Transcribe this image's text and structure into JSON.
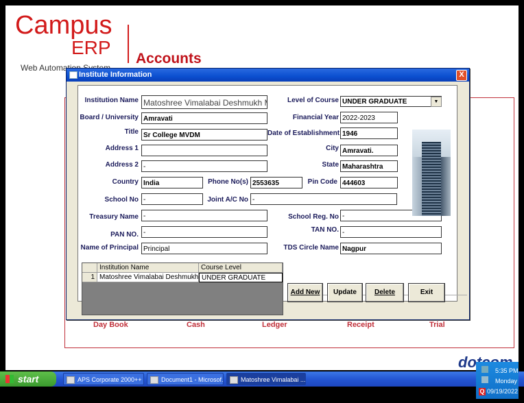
{
  "app": {
    "logo_campus": "Campus",
    "logo_erp": "ERP",
    "logo_subtitle": "Web Automation System",
    "module_title": "Accounts",
    "brand_footer": "dotcom"
  },
  "background_tabs": [
    "Day Book",
    "Cash",
    "Ledger",
    "Receipt",
    "Trial"
  ],
  "dialog": {
    "title": "Institute Information",
    "close": "X",
    "labels": {
      "institution_name": "Institution Name",
      "board_university": "Board / University",
      "title": "Title",
      "address1": "Address 1",
      "address2": "Address 2",
      "country": "Country",
      "phone": "Phone No(s)",
      "pin_code": "Pin Code",
      "school_no": "School No",
      "joint_ac": "Joint A/C No",
      "treasury_name": "Treasury Name",
      "school_reg_no": "School Reg. No",
      "pan_no": "PAN NO.",
      "tan_no": "TAN NO.",
      "principal": "Name of Principal",
      "tds_circle": "TDS Circle Name",
      "level_of_course": "Level of Course",
      "financial_year": "Financial Year",
      "date_established": "Date of Establishment",
      "city": "City",
      "state": "State"
    },
    "values": {
      "institution_name": "Matoshree Vimalabai Deshmukh M",
      "board_university": "Amravati",
      "title": "Sr College MVDM",
      "address1": "",
      "address2": "-",
      "country": "India",
      "phone": "2553635",
      "pin_code": "444603",
      "school_no": "-",
      "joint_ac": "-",
      "treasury_name": "-",
      "school_reg_no": "-",
      "pan_no": "-",
      "tan_no": "-",
      "principal": "Principal",
      "tds_circle": "Nagpur",
      "level_of_course": "UNDER GRADUATE",
      "financial_year": "2022-2023",
      "date_established": "1946",
      "city": "Amravati.",
      "state": "Maharashtra"
    },
    "grid": {
      "columns": [
        "Institution Name",
        "Course Level"
      ],
      "rows": [
        {
          "num": "1",
          "name": "Matoshree Vimalabai Deshmukh",
          "level": "UNDER GRADUATE"
        }
      ]
    },
    "buttons": {
      "add_new": "Add New",
      "update": "Update",
      "delete": "Delete",
      "exit": "Exit"
    }
  },
  "taskbar": {
    "start": "start",
    "items": [
      "APS Corporate 2000++",
      "Document1 - Microsof...",
      "Matoshree Vimalabai ..."
    ],
    "clock": "5:35 PM",
    "day": "Monday",
    "date": "09/19/2022"
  }
}
